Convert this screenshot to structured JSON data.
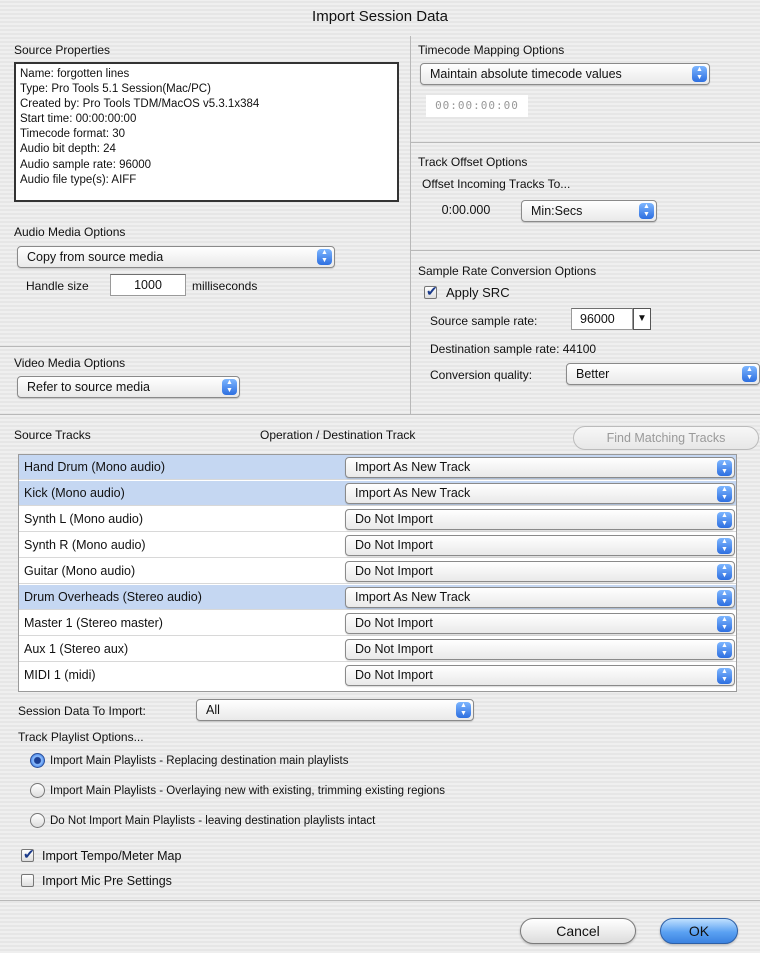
{
  "window": {
    "title": "Import Session Data"
  },
  "source_properties": {
    "label": "Source Properties",
    "lines": [
      "Name: forgotten lines",
      "Type: Pro Tools 5.1 Session(Mac/PC)",
      "Created by: Pro Tools TDM/MacOS v5.3.1x384",
      "Start time: 00:00:00:00",
      "Timecode format: 30",
      "Audio bit depth: 24",
      "Audio sample rate: 96000",
      "Audio file type(s): AIFF"
    ]
  },
  "timecode_mapping": {
    "label": "Timecode Mapping Options",
    "selected": "Maintain absolute timecode values",
    "timecode": "00:00:00:00"
  },
  "track_offset": {
    "label": "Track Offset Options",
    "sub_label": "Offset Incoming Tracks To...",
    "value": "0:00.000",
    "unit": "Min:Secs"
  },
  "audio_media": {
    "label": "Audio Media Options",
    "selected": "Copy from source media",
    "handle_label": "Handle size",
    "handle_value": "1000",
    "handle_unit": "milliseconds"
  },
  "sample_rate": {
    "label": "Sample Rate Conversion Options",
    "apply_label": "Apply SRC",
    "apply_checked": true,
    "source_label": "Source sample rate:",
    "source_value": "96000",
    "dest_label": "Destination sample rate: 44100",
    "quality_label": "Conversion quality:",
    "quality_value": "Better"
  },
  "video_media": {
    "label": "Video Media Options",
    "selected": "Refer to source media"
  },
  "source_tracks": {
    "label": "Source Tracks",
    "operation_label": "Operation / Destination Track",
    "find_button": "Find Matching Tracks",
    "rows": [
      {
        "name": "Hand Drum (Mono audio)",
        "operation": "Import As New Track",
        "selected": true
      },
      {
        "name": "Kick (Mono audio)",
        "operation": "Import As New Track",
        "selected": true
      },
      {
        "name": "Synth L (Mono audio)",
        "operation": "Do Not Import",
        "selected": false
      },
      {
        "name": "Synth R (Mono audio)",
        "operation": "Do Not Import",
        "selected": false
      },
      {
        "name": "Guitar (Mono audio)",
        "operation": "Do Not Import",
        "selected": false
      },
      {
        "name": "Drum Overheads (Stereo audio)",
        "operation": "Import As New Track",
        "selected": true
      },
      {
        "name": "Master 1 (Stereo master)",
        "operation": "Do Not Import",
        "selected": false
      },
      {
        "name": "Aux 1 (Stereo aux)",
        "operation": "Do Not Import",
        "selected": false
      },
      {
        "name": "MIDI 1 (midi)",
        "operation": "Do Not Import",
        "selected": false
      }
    ]
  },
  "session_data": {
    "label": "Session Data To Import:",
    "selected": "All"
  },
  "playlist_options": {
    "label": "Track Playlist Options...",
    "options": [
      {
        "label": "Import Main Playlists - Replacing destination main playlists",
        "selected": true
      },
      {
        "label": "Import Main Playlists - Overlaying new with existing, trimming existing regions",
        "selected": false
      },
      {
        "label": "Do Not Import Main Playlists - leaving destination playlists intact",
        "selected": false
      }
    ]
  },
  "checkboxes": {
    "tempo_label": "Import Tempo/Meter Map",
    "tempo_checked": true,
    "mic_label": "Import Mic Pre Settings",
    "mic_checked": false
  },
  "buttons": {
    "cancel": "Cancel",
    "ok": "OK"
  },
  "colors": {
    "accent": "#3b82e0",
    "row_selected": "#c5d7f2"
  }
}
